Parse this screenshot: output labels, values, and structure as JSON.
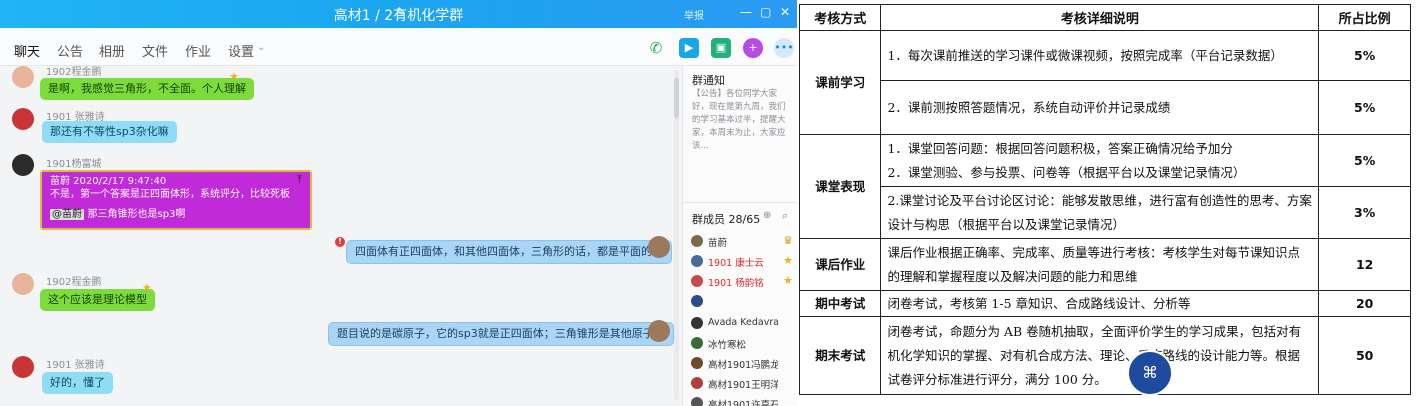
{
  "window": {
    "title": "高材1 / 2有机化学群",
    "report_label": "举报",
    "controls": [
      "—",
      "▢",
      "✕"
    ]
  },
  "tabs": [
    "聊天",
    "公告",
    "相册",
    "文件",
    "作业",
    "设置"
  ],
  "messages": [
    {
      "sender": "1902程金鹏",
      "text": "是啊，我感觉三角形，不全面。个人理解",
      "style": "green"
    },
    {
      "sender": "1901 张雅诗",
      "text": "那还有不等性sp3杂化嘛",
      "style": "cyan"
    },
    {
      "sender": "1901杨富城",
      "quote_header": "苗蔚  2020/2/17 9:47:40",
      "quote_text": "不是，第一个答案是正四面体形，系统评分，比较死板",
      "mention": "@苗蔚",
      "text": "那三角锥形也是sp3啊",
      "style": "purple"
    },
    {
      "sender": "",
      "text": "四面体有正四面体，和其他四面体，三角形的话，都是平面的吧",
      "style": "blue-right"
    },
    {
      "sender": "1902程金鹏",
      "text": "这个应该是理论模型",
      "style": "green"
    },
    {
      "sender": "",
      "text": "题目说的是碳原子，它的sp3就是正四面体；三角锥形是其他原子的",
      "style": "blue-right"
    },
    {
      "sender": "1901 张雅诗",
      "text": "好的，懂了",
      "style": "cyan"
    }
  ],
  "notice": {
    "title": "群通知",
    "body": "【公告】各位同学大家好，现在是第九周，我们的学习基本过半，提醒大家，本周末为止，大家应该..."
  },
  "members": {
    "title": "群成员 28/65",
    "list": [
      {
        "name": "苗蔚",
        "red": false
      },
      {
        "name": "1901  康士云",
        "red": true
      },
      {
        "name": "1901  杨韵铭",
        "red": true
      },
      {
        "name": "",
        "red": false
      },
      {
        "name": "Avada Kedavra",
        "red": false
      },
      {
        "name": "冰竹寒松",
        "red": false
      },
      {
        "name": "高材1901冯鹏龙",
        "red": false
      },
      {
        "name": "高材1901王明洋",
        "red": false
      },
      {
        "name": "高材1901许嘉石",
        "red": false
      }
    ]
  },
  "table": {
    "headers": [
      "考核方式",
      "考核详细说明",
      "所占比例"
    ],
    "groups": [
      {
        "method": "课前学习",
        "rows": [
          {
            "detail": "1．每次课前推送的学习课件或微课视频，按照完成率（平台记录数据）",
            "pct": "5%"
          },
          {
            "detail": "2．课前测按照答题情况，系统自动评价并记录成绩",
            "pct": "5%"
          }
        ]
      },
      {
        "method": "课堂表现",
        "rows": [
          {
            "detail": "1．课堂回答问题：根据回答问题积极，答案正确情况给予加分\n2．课堂测验、参与投票、问卷等（根据平台以及课堂记录情况）",
            "pct": "5%"
          },
          {
            "detail": "2.课堂讨论及平台讨论区讨论：能够发散思维，进行富有创造性的思考、方案设计与构思（根据平台以及课堂记录情况）",
            "pct": "3%"
          }
        ]
      },
      {
        "method": "课后作业",
        "rows": [
          {
            "detail": "课后作业根据正确率、完成率、质量等进行考核：考核学生对每节课知识点的理解和掌握程度以及解决问题的能力和思维",
            "pct": "12"
          }
        ]
      },
      {
        "method": "期中考试",
        "rows": [
          {
            "detail": "闭卷考试，考核第 1-5 章知识、合成路线设计、分析等",
            "pct": "20"
          }
        ]
      },
      {
        "method": "期末考试",
        "rows": [
          {
            "detail": "闭卷考试，命题分为 AB 卷随机抽取，全面评价学生的学习成果，包括对有机化学知识的掌握、对有机合成方法、理论、反应路线的设计能力等。根据试卷评分标准进行评分，满分 100 分。",
            "pct": "50"
          }
        ]
      }
    ]
  },
  "colors": {
    "titlebar": "#1aa7f0",
    "accent": "#1aa7f0",
    "green_bubble": "#7ddb3e",
    "purple_bubble": "#c02ad8"
  }
}
